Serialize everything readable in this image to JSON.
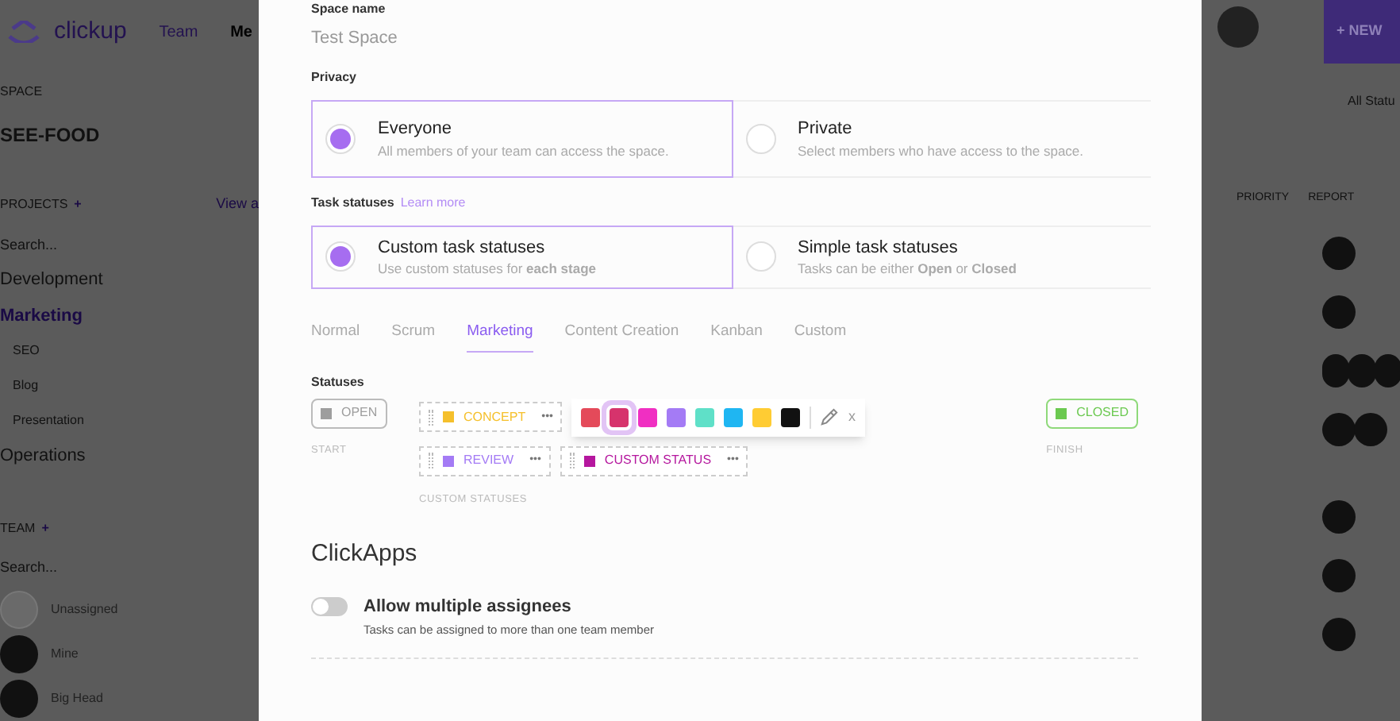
{
  "app_header": {
    "logo_text": "clickup",
    "nav": [
      {
        "label": "Team",
        "selected": false
      },
      {
        "label": "Me",
        "selected": true
      }
    ],
    "new_button": "+ NEW"
  },
  "sidebar": {
    "space_label": "SPACE",
    "space_name": "SEE-FOOD",
    "projects_label": "PROJECTS",
    "add": "+",
    "view_all": "View a",
    "search": "Search...",
    "projects": [
      {
        "label": "Development",
        "selected": false
      },
      {
        "label": "Marketing",
        "selected": true,
        "children": [
          {
            "label": "SEO"
          },
          {
            "label": "Blog"
          },
          {
            "label": "Presentation"
          }
        ]
      },
      {
        "label": "Operations",
        "selected": false
      }
    ],
    "team_label": "TEAM",
    "team_add": "+",
    "team_search": "Search...",
    "members": [
      {
        "name": "Unassigned",
        "kind": "empty"
      },
      {
        "name": "Mine",
        "kind": "person"
      },
      {
        "name": "Big Head",
        "kind": "person"
      }
    ]
  },
  "right_panel": {
    "filter": "All Statu",
    "columns": [
      "PRIORITY",
      "REPORT"
    ]
  },
  "modal": {
    "space_name_label": "Space name",
    "space_name_value": "Test Space",
    "privacy_label": "Privacy",
    "privacy_options": [
      {
        "title": "Everyone",
        "description": "All members of your team can access the space.",
        "selected": true
      },
      {
        "title": "Private",
        "description": "Select members who have access to the space.",
        "selected": false
      }
    ],
    "task_statuses_label": "Task statuses",
    "learn_more": "Learn more",
    "status_options": [
      {
        "title": "Custom task statuses",
        "description": "Use custom statuses for **each stage**",
        "selected": true
      },
      {
        "title": "Simple task statuses",
        "description": "Tasks can be either **Open** or **Closed**",
        "selected": false
      }
    ],
    "templates": [
      {
        "label": "Normal",
        "selected": false
      },
      {
        "label": "Scrum",
        "selected": false
      },
      {
        "label": "Marketing",
        "selected": true
      },
      {
        "label": "Content Creation",
        "selected": false
      },
      {
        "label": "Kanban",
        "selected": false
      },
      {
        "label": "Custom",
        "selected": false
      }
    ],
    "statuses_label": "Statuses",
    "open_status": {
      "label": "OPEN",
      "color": "#9e9e9e"
    },
    "start_label": "START",
    "custom_statuses": [
      {
        "label": "CONCEPT",
        "color": "#f5c02c",
        "menu": "•••"
      },
      {
        "label": "REVIEW",
        "color": "#a47bf5",
        "menu": "•••"
      },
      {
        "label": "CUSTOM STATUS",
        "color": "#b5179e",
        "menu": "•••"
      }
    ],
    "custom_statuses_label": "CUSTOM STATUSES",
    "closed_status": {
      "label": "CLOSED",
      "color": "#6bc950"
    },
    "finish_label": "FINISH",
    "swatches": [
      {
        "color": "#e44a5a",
        "selected": false
      },
      {
        "color": "#d6336c",
        "selected": true
      },
      {
        "color": "#f02fc2",
        "selected": false
      },
      {
        "color": "#a47bf5",
        "selected": false
      },
      {
        "color": "#5fe0c8",
        "selected": false
      },
      {
        "color": "#1fb6f2",
        "selected": false
      },
      {
        "color": "#ffcc33",
        "selected": false
      },
      {
        "color": "#111111",
        "selected": false
      }
    ],
    "close_picker": "x",
    "clickapps_title": "ClickApps",
    "clickapps": [
      {
        "title": "Allow multiple assignees",
        "description": "Tasks can be assigned to more than one team member",
        "on": false
      }
    ]
  }
}
